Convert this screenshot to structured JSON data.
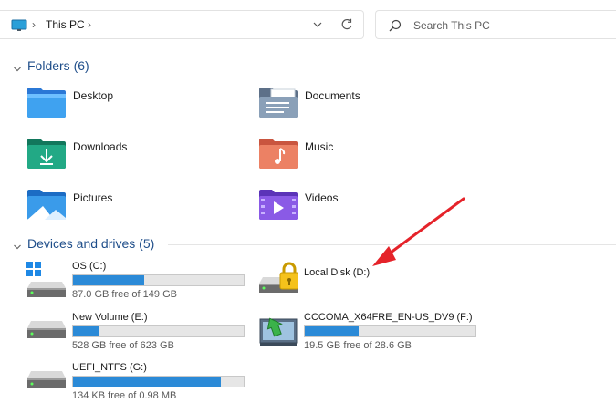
{
  "address_bar": {
    "location_icon": "this-pc-monitor-icon",
    "breadcrumb": "This PC",
    "separator": "›",
    "history_icon": "chevron-down-icon",
    "refresh_icon": "refresh-icon"
  },
  "search": {
    "placeholder": "Search This PC",
    "icon": "search-icon"
  },
  "folders_section": {
    "title": "Folders (6)",
    "items": [
      {
        "label": "Desktop",
        "icon": "desktop-folder-icon",
        "color": "#3a8ee6"
      },
      {
        "label": "Documents",
        "icon": "documents-folder-icon",
        "color": "#7a8fa6"
      },
      {
        "label": "Downloads",
        "icon": "downloads-folder-icon",
        "color": "#1f9e7a"
      },
      {
        "label": "Music",
        "icon": "music-folder-icon",
        "color": "#e2735c"
      },
      {
        "label": "Pictures",
        "icon": "pictures-folder-icon",
        "color": "#2d8ee0"
      },
      {
        "label": "Videos",
        "icon": "videos-folder-icon",
        "color": "#7b4fd6"
      }
    ]
  },
  "drives_section": {
    "title": "Devices and drives (5)",
    "items": [
      {
        "name": "OS (C:)",
        "free": "87.0 GB free of 149 GB",
        "used_fraction": 0.416,
        "icon": "windows-drive-icon"
      },
      {
        "name": "Local Disk (D:)",
        "free": "",
        "used_fraction": null,
        "icon": "locked-drive-icon"
      },
      {
        "name": "New Volume (E:)",
        "free": "528 GB free of 623 GB",
        "used_fraction": 0.152,
        "icon": "hard-drive-icon"
      },
      {
        "name": "CCCOMA_X64FRE_EN-US_DV9 (F:)",
        "free": "19.5 GB free of 28.6 GB",
        "used_fraction": 0.318,
        "icon": "dvd-drive-icon"
      },
      {
        "name": "UEFI_NTFS (G:)",
        "free": "134 KB free of 0.98 MB",
        "used_fraction": 0.866,
        "icon": "hard-drive-icon"
      }
    ]
  },
  "annotation": {
    "icon": "red-arrow-annotation",
    "color": "#e5232a"
  },
  "colors": {
    "accent": "#1f4e8a",
    "bar_fill": "#2b8ad7"
  }
}
